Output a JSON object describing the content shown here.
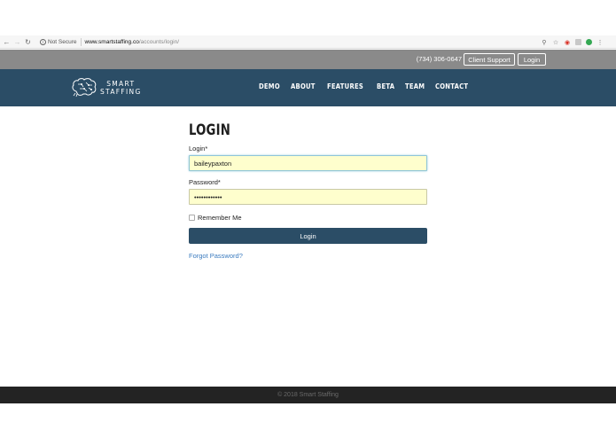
{
  "browser": {
    "back_icon": "back-arrow-icon",
    "forward_icon": "forward-arrow-icon",
    "reload_icon": "reload-icon",
    "security_text": "Not Secure",
    "url_host": "www.smartstaffing.co",
    "url_path": "/accounts/login/"
  },
  "utility_bar": {
    "phone": "(734) 306-0647",
    "client_support_label": "Client Support",
    "login_label": "Login"
  },
  "header": {
    "logo_line1": "SMART",
    "logo_line2": "STAFFING",
    "nav": [
      "DEMO",
      "ABOUT",
      "FEATURES",
      "BETA",
      "TEAM",
      "CONTACT"
    ]
  },
  "form": {
    "title": "LOGIN",
    "login_label": "Login*",
    "login_value": "baileypaxton",
    "password_label": "Password*",
    "password_value": "••••••••••••",
    "remember_label": "Remember Me",
    "submit_label": "Login",
    "forgot_label": "Forgot Password?"
  },
  "footer": {
    "copyright": "© 2018 Smart Staffing"
  },
  "colors": {
    "header_bg": "#2b4d66",
    "utility_bg": "#8a8a8a",
    "input_bg": "#fefecd",
    "link": "#3b7bbf",
    "footer_bg": "#232323"
  }
}
